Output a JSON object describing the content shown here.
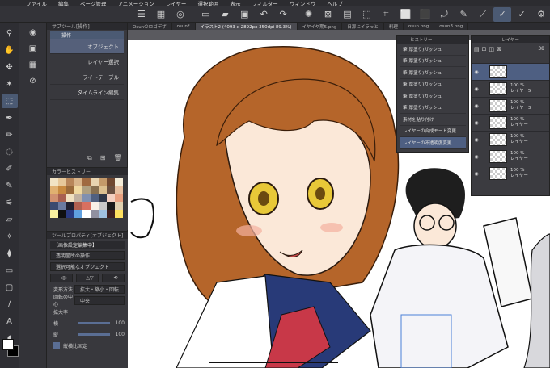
{
  "menu": {
    "items": [
      "ファイル",
      "編集",
      "ページ管理",
      "アニメーション",
      "レイヤー",
      "選択範囲",
      "表示",
      "フィルター",
      "ウィンドウ",
      "ヘルプ"
    ]
  },
  "sub_tool_panel": {
    "header": "サブツール[操作]",
    "tab_label": "操作",
    "items": [
      {
        "label": "オブジェクト",
        "active": true
      },
      {
        "label": "レイヤー選択",
        "active": false
      },
      {
        "label": "ライトテーブル",
        "active": false
      },
      {
        "label": "タイムライン編集",
        "active": false
      }
    ]
  },
  "color_history": {
    "header": "カラーヒストリー",
    "colors": [
      "#f2e4c4",
      "#e6c89a",
      "#b8865a",
      "#d8b48a",
      "#a06a40",
      "#e8d4b0",
      "#c49a6a",
      "#704830",
      "#f4ecd8",
      "#e0b070",
      "#c88a40",
      "#9a6a3a",
      "#f0d8a0",
      "#b0a080",
      "#887050",
      "#dcc090",
      "#6a5040",
      "#e8c0a0",
      "#d09070",
      "#a86050",
      "#f0e0c0",
      "#c0b0a0",
      "#8090b0",
      "#506080",
      "#303848",
      "#f4d0c0",
      "#e8a080",
      "#3a4a70",
      "#6a7aa0",
      "#202030",
      "#b06050",
      "#d87060",
      "#f8f0e8",
      "#c8c8c8",
      "#1a1a1a",
      "#e0d0b0",
      "#f8f0a0",
      "#101010",
      "#2a3a80",
      "#60a0e0",
      "#ffffff",
      "#9090a0",
      "#a0c0e0",
      "#402020",
      "#ffe060"
    ]
  },
  "tool_property": {
    "header": "ツールプロパティ[オブジェクト]",
    "title": "【画像設定編集中】",
    "select1": "透明箇所の操作",
    "select2": "選択可能なオブジェクト",
    "transform_label": "変形方法",
    "transform_value": "拡大・縮小・回転",
    "center_label": "回転の中心",
    "center_value": "中央",
    "scale_label": "拡大率",
    "width_label": "横",
    "width_value": "100",
    "height_label": "縦",
    "height_value": "100",
    "keep_ratio_label": "縦横比固定"
  },
  "tabs": [
    {
      "label": "Osunのロゴデザ",
      "active": false
    },
    {
      "label": "osun*",
      "active": false
    },
    {
      "label": "イラスト2 (4093 x 2892px 350dpi 89.3%)",
      "active": true
    },
    {
      "label": "イヤイヤ期5.png",
      "active": false
    },
    {
      "label": "日那にイラっと",
      "active": false
    },
    {
      "label": "料理",
      "active": false
    },
    {
      "label": "osun.png",
      "active": false
    },
    {
      "label": "osun3.png",
      "active": false
    }
  ],
  "history": {
    "header": "ヒストリー",
    "items": [
      {
        "label": "筆(厚塗り)ガッシュ",
        "active": false
      },
      {
        "label": "筆(厚塗り)ガッシュ",
        "active": false
      },
      {
        "label": "筆(厚塗り)ガッシュ",
        "active": false
      },
      {
        "label": "筆(厚塗り)ガッシュ",
        "active": false
      },
      {
        "label": "筆(厚塗り)ガッシュ",
        "active": false
      },
      {
        "label": "筆(厚塗り)ガッシュ",
        "active": false
      },
      {
        "label": "素材を貼り付け",
        "active": false
      },
      {
        "label": "レイヤーの合成モード変更",
        "active": false
      },
      {
        "label": "レイヤーの不透明度変更",
        "active": true
      }
    ]
  },
  "layers": {
    "header": "レイヤー",
    "opacity": "38",
    "rows": [
      {
        "percent": "",
        "name": "",
        "active": true
      },
      {
        "percent": "100 %",
        "name": "レイヤー5",
        "active": false
      },
      {
        "percent": "100 %",
        "name": "レイヤー3",
        "active": false
      },
      {
        "percent": "100 %",
        "name": "レイヤー",
        "active": false
      },
      {
        "percent": "100 %",
        "name": "レイヤー",
        "active": false
      },
      {
        "percent": "100 %",
        "name": "レイヤー",
        "active": false
      },
      {
        "percent": "100 %",
        "name": "レイヤー",
        "active": false
      }
    ]
  },
  "colors": {
    "accent": "#4e5f82",
    "hair": "#b5652a",
    "eye": "#e8c838",
    "uniform_navy": "#283a78",
    "ribbon": "#c83848"
  }
}
